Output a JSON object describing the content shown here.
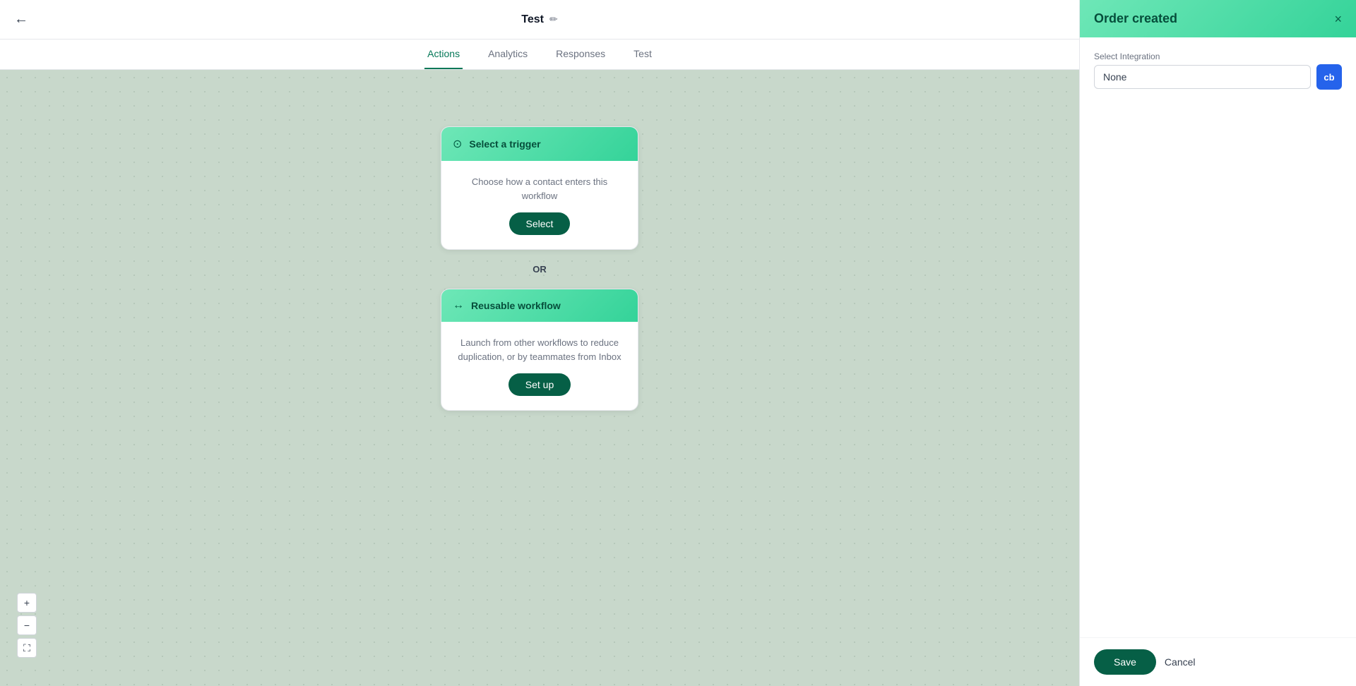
{
  "header": {
    "back_label": "←",
    "title": "Test",
    "edit_icon": "✏"
  },
  "nav": {
    "tabs": [
      {
        "label": "Actions",
        "active": true
      },
      {
        "label": "Analytics",
        "active": false
      },
      {
        "label": "Responses",
        "active": false
      },
      {
        "label": "Test",
        "active": false
      }
    ]
  },
  "canvas": {
    "trigger_card": {
      "header_icon": "⊙",
      "header_title": "Select a trigger",
      "description": "Choose how a contact enters this workflow",
      "button_label": "Select"
    },
    "or_label": "OR",
    "reusable_card": {
      "header_icon": "↔",
      "header_title": "Reusable workflow",
      "description": "Launch from other workflows to reduce duplication, or by teammates from Inbox",
      "button_label": "Set up"
    }
  },
  "zoom_controls": {
    "zoom_in": "+",
    "zoom_out": "−",
    "fit_icon": "⛶"
  },
  "right_panel": {
    "title": "Order created",
    "close_icon": "×",
    "integration_label": "Select Integration",
    "integration_value": "None",
    "integration_badge": "cb",
    "footer": {
      "save_label": "Save",
      "cancel_label": "Cancel"
    }
  }
}
